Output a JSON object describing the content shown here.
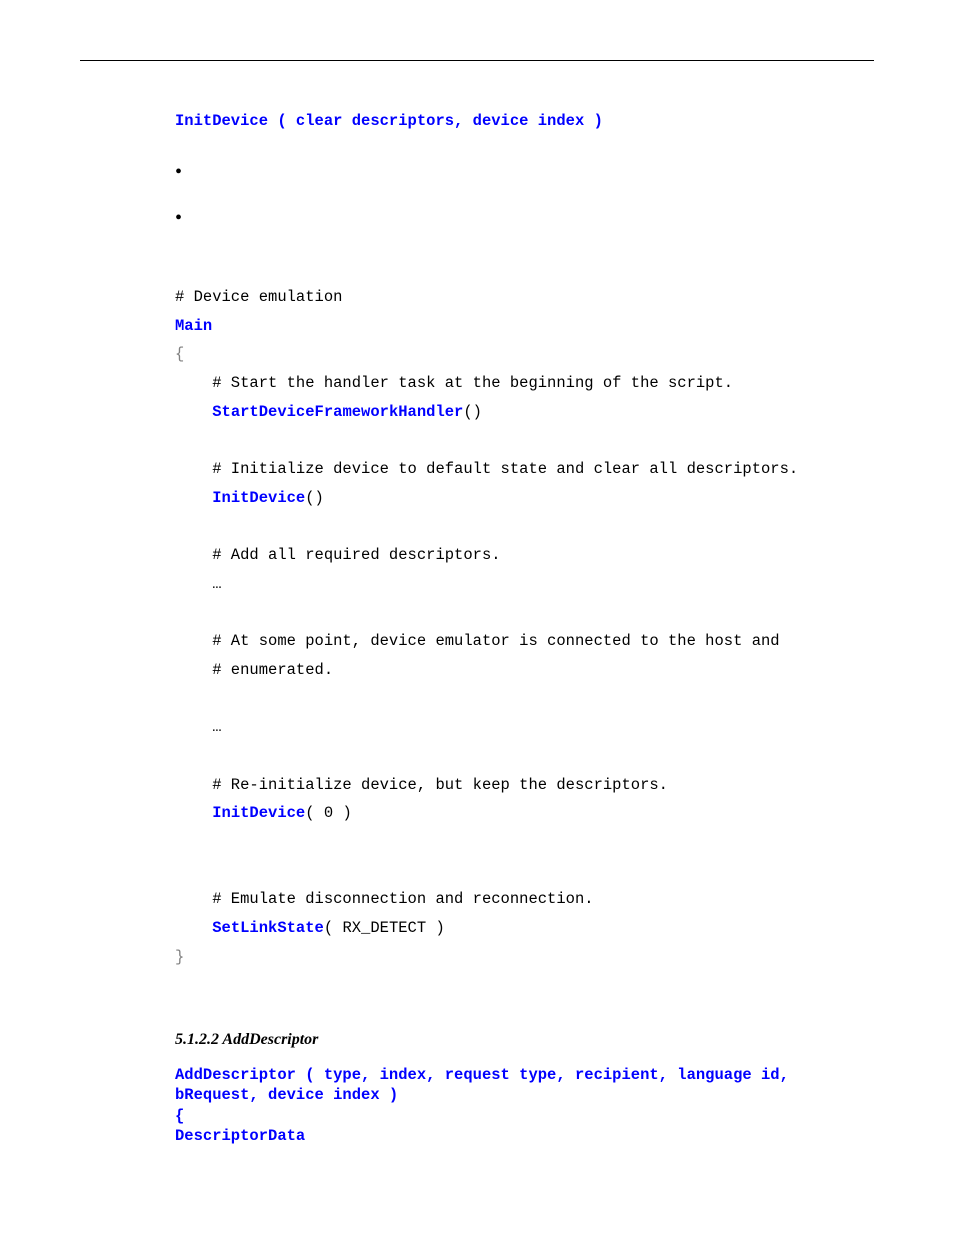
{
  "sig1": "InitDevice ( clear descriptors, device index )",
  "code": {
    "c1": "# Device emulation",
    "c2": "Main",
    "c3": "{",
    "c4": "    # Start the handler task at the beginning of the script.",
    "c5a": "    ",
    "c5b": "StartDeviceFrameworkHandler",
    "c5c": "()",
    "c6": "    # Initialize device to default state and clear all descriptors.",
    "c7a": "    ",
    "c7b": "InitDevice",
    "c7c": "()",
    "c8": "    # Add all required descriptors.",
    "c9": "    …",
    "c10": "    # At some point, device emulator is connected to the host and",
    "c11": "    # enumerated.",
    "c12": "    …",
    "c13": "    # Re-initialize device, but keep the descriptors.",
    "c14a": "    ",
    "c14b": "InitDevice",
    "c14c": "( 0 )",
    "c15": "    # Emulate disconnection and reconnection.",
    "c16a": "    ",
    "c16b": "SetLinkState",
    "c16c": "( RX_DETECT )",
    "c17": "}"
  },
  "heading2": "5.1.2.2 AddDescriptor",
  "sig2a": "AddDescriptor ( type, index, request type, recipient, language id,",
  "sig2b": "bRequest, device index )",
  "sig2c": "{",
  "sig2d": "    DescriptorData"
}
